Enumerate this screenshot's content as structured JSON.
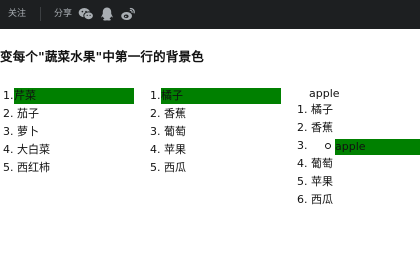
{
  "topbar": {
    "follow_label": "关注",
    "share_label": "分享",
    "share_icons": [
      "wechat-icon",
      "qq-icon",
      "weibo-icon"
    ]
  },
  "page_title": "变每个\"蔬菜水果\"中第一行的背景色",
  "highlight_color": "#008000",
  "list1": [
    "1.",
    "芹菜",
    "2.",
    "茄子",
    "3.",
    "萝卜",
    "4.",
    "大白菜",
    "5.",
    "西红柿"
  ],
  "list2": [
    "1.",
    "橘子",
    "2.",
    "香蕉",
    "3.",
    "葡萄",
    "4.",
    "苹果",
    "5.",
    "西瓜"
  ],
  "list3": {
    "intro": "apple",
    "items": [
      "1.",
      "橘子",
      "2.",
      "香蕉",
      "3.",
      "apple",
      "4.",
      "葡萄",
      "5.",
      "苹果",
      "6.",
      "西瓜"
    ]
  }
}
